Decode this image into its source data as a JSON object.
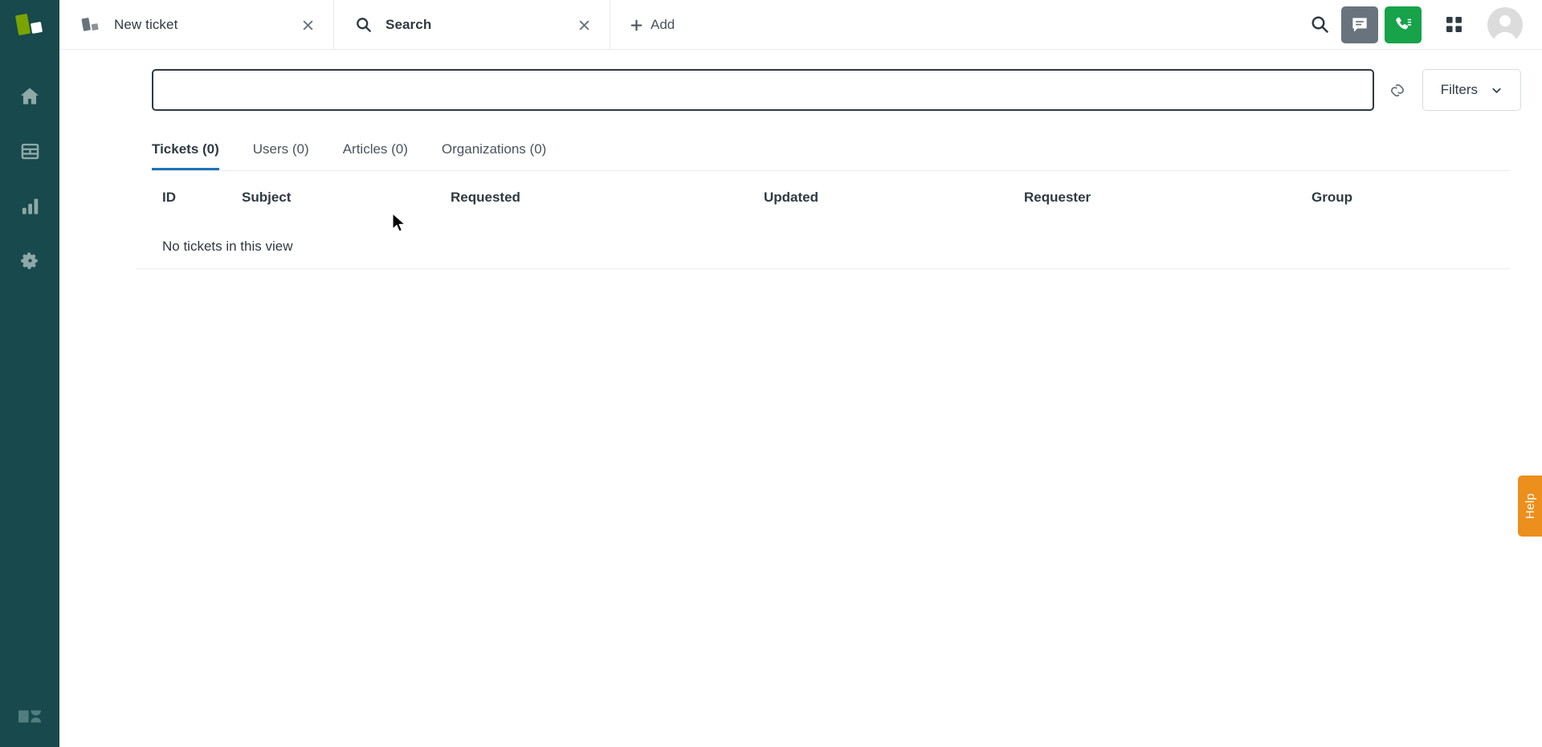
{
  "sidebar": {
    "brand_logo_icon": "product-logo-green-white",
    "items": [
      {
        "icon": "home-icon",
        "name": "home"
      },
      {
        "icon": "views-icon",
        "name": "views"
      },
      {
        "icon": "reporting-icon",
        "name": "reporting"
      },
      {
        "icon": "gear-icon",
        "name": "admin"
      }
    ],
    "footer_logo_icon": "zendesk-logo"
  },
  "topbar": {
    "tabs": [
      {
        "label": "New ticket",
        "icon": "ticket-logo-icon",
        "active": false,
        "close_icon": "close-icon"
      },
      {
        "label": "Search",
        "icon": "search-icon",
        "active": true,
        "close_icon": "close-icon"
      }
    ],
    "add_label": "Add",
    "add_icon": "plus-icon",
    "search_icon": "search-icon",
    "chat_icon": "chat-icon",
    "call_icon": "call-icon",
    "apps_icon": "apps-grid-icon",
    "avatar_icon": "avatar",
    "chat_color": "#68737d",
    "call_color": "#16a34a"
  },
  "search": {
    "value": "",
    "placeholder": "",
    "link_icon": "link-icon",
    "filters_label": "Filters",
    "filters_chevron_icon": "chevron-down-icon"
  },
  "result_tabs": [
    {
      "label": "Tickets (0)",
      "active": true
    },
    {
      "label": "Users (0)",
      "active": false
    },
    {
      "label": "Articles (0)",
      "active": false
    },
    {
      "label": "Organizations (0)",
      "active": false
    }
  ],
  "accent_color": "#1f73b7",
  "table": {
    "headers": {
      "id": "ID",
      "subject": "Subject",
      "requested": "Requested",
      "updated": "Updated",
      "requester": "Requester",
      "group": "Group"
    },
    "rows": [],
    "empty_message": "No tickets in this view"
  },
  "help": {
    "label": "Help",
    "color": "#ed8f1c"
  }
}
